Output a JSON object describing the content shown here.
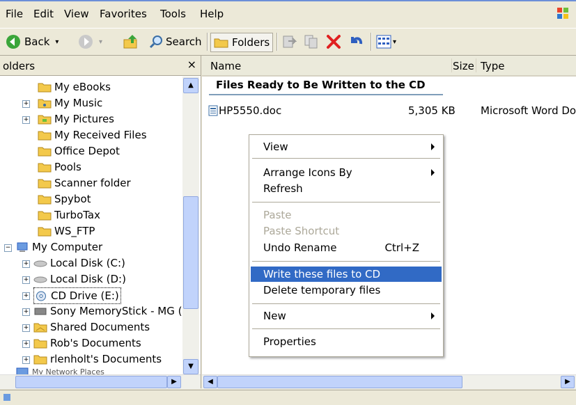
{
  "menubar": {
    "items": [
      "File",
      "Edit",
      "View",
      "Favorites",
      "Tools",
      "Help"
    ]
  },
  "toolbar": {
    "back_label": "Back",
    "search_label": "Search",
    "folders_label": "Folders"
  },
  "folders": {
    "title": "olders",
    "close": "×",
    "items": [
      {
        "label": "My eBooks"
      },
      {
        "label": "My Music"
      },
      {
        "label": "My Pictures"
      },
      {
        "label": "My Received Files"
      },
      {
        "label": "Office Depot"
      },
      {
        "label": "Pools"
      },
      {
        "label": "Scanner folder"
      },
      {
        "label": "Spybot"
      },
      {
        "label": "TurboTax"
      },
      {
        "label": "WS_FTP"
      },
      {
        "label": "My Computer"
      },
      {
        "label": "Local Disk (C:)"
      },
      {
        "label": "Local Disk (D:)"
      },
      {
        "label": "CD Drive (E:)"
      },
      {
        "label": "Sony MemoryStick - MG ("
      },
      {
        "label": "Shared Documents"
      },
      {
        "label": "Rob's Documents"
      },
      {
        "label": "rlenholt's Documents"
      },
      {
        "label": "My Network Places"
      }
    ]
  },
  "filepane": {
    "columns": {
      "name": "Name",
      "size": "Size",
      "type": "Type"
    },
    "group_header": "Files Ready to Be Written to the CD",
    "files": [
      {
        "name": "HP5550.doc",
        "size": "5,305 KB",
        "type": "Microsoft Word Do"
      }
    ]
  },
  "context_menu": {
    "view": "View",
    "arrange": "Arrange Icons By",
    "refresh": "Refresh",
    "paste": "Paste",
    "paste_shortcut": "Paste Shortcut",
    "undo_rename": "Undo Rename",
    "undo_shortcut": "Ctrl+Z",
    "write_cd": "Write these files to CD",
    "delete_temp": "Delete temporary files",
    "new": "New",
    "properties": "Properties"
  },
  "colors": {
    "highlight": "#316ac5",
    "folder": "#f3c94b",
    "chrome": "#ece9d8"
  }
}
